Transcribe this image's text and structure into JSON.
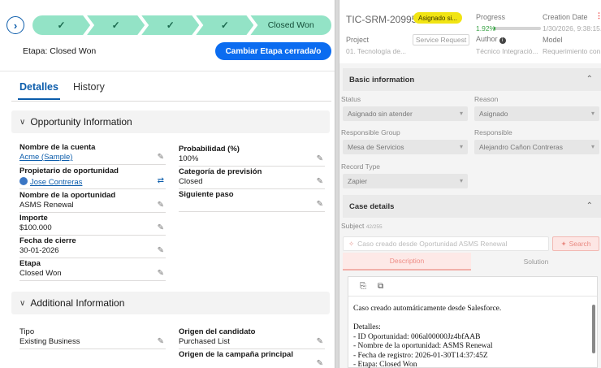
{
  "left": {
    "path": {
      "steps": [
        "✓",
        "✓",
        "✓",
        "✓"
      ],
      "current": "Closed Won",
      "toggle_icon": "chevron-right-icon"
    },
    "stage_label": "Etapa: Closed Won",
    "stage_button": "Cambiar Etapa cerrada/o",
    "tabs": [
      "Detalles",
      "History"
    ],
    "sections": {
      "opportunity": "Opportunity Information",
      "additional": "Additional Information"
    },
    "fields": {
      "cuenta": {
        "label": "Nombre de la cuenta",
        "value": "Acme (Sample)"
      },
      "propietario": {
        "label": "Propietario de oportunidad",
        "value": "Jose Contreras"
      },
      "nombre_op": {
        "label": "Nombre de la oportunidad",
        "value": "ASMS Renewal"
      },
      "importe": {
        "label": "Importe",
        "value": "$100.000"
      },
      "fecha_cierre": {
        "label": "Fecha de cierre",
        "value": "30-01-2026"
      },
      "etapa": {
        "label": "Etapa",
        "value": "Closed Won"
      },
      "probabilidad": {
        "label": "Probabilidad (%)",
        "value": "100%"
      },
      "categoria": {
        "label": "Categoría de previsión",
        "value": "Closed"
      },
      "siguiente": {
        "label": "Siguiente paso",
        "value": ""
      },
      "tipo": {
        "label": "Tipo",
        "value": "Existing Business"
      },
      "origen_candidato": {
        "label": "Origen del candidato",
        "value": "Purchased List"
      },
      "origen_campana": {
        "label": "Origen de la campaña principal",
        "value": ""
      }
    }
  },
  "right": {
    "ticket_id": "TIC-SRM-20995",
    "status_chip": "Asignado si...",
    "progress": {
      "label": "Progress",
      "value": "1.92%",
      "fraction": 0.0192
    },
    "creation": {
      "label": "Creation Date",
      "value": "1/30/2026, 9:38:15..."
    },
    "project": {
      "label": "Project",
      "value": "01. Tecnología de..."
    },
    "service_request": "Service Request",
    "author": {
      "label": "Author",
      "value": "Técnico Integració..."
    },
    "model": {
      "label": "Model",
      "value": "Requerimiento con..."
    },
    "basic_section": "Basic information",
    "status": {
      "label": "Status",
      "value": "Asignado sin atender"
    },
    "reason": {
      "label": "Reason",
      "value": "Asignado"
    },
    "responsible_group": {
      "label": "Responsible Group",
      "value": "Mesa de Servicios"
    },
    "responsible": {
      "label": "Responsible",
      "value": "Alejandro Cañon Contreras"
    },
    "record_type": {
      "label": "Record Type",
      "value": "Zapier"
    },
    "case_section": "Case details",
    "subject": {
      "label": "Subject",
      "counter": "42/255",
      "value": "Caso creado desde Oportunidad ASMS Renewal"
    },
    "search_button": "Search",
    "tabs": {
      "description": "Description",
      "solution": "Solution"
    },
    "editor": {
      "line1": "Caso creado automáticamente desde Salesforce.",
      "line2": "Detalles:",
      "line3": "- ID Oportunidad: 006al00000Jz4bfAAB",
      "line4": "- Nombre de la oportunidad:  ASMS Renewal",
      "line5": "- Fecha de registro: 2026-01-30T14:37:45Z",
      "line6": "- Etapa: Closed Won"
    }
  },
  "colors": {
    "path_complete": "#93e3c6",
    "brand_blue": "#0b6cf0",
    "status_yellow": "#f1e413",
    "accent_salmon": "#ee8d86"
  }
}
